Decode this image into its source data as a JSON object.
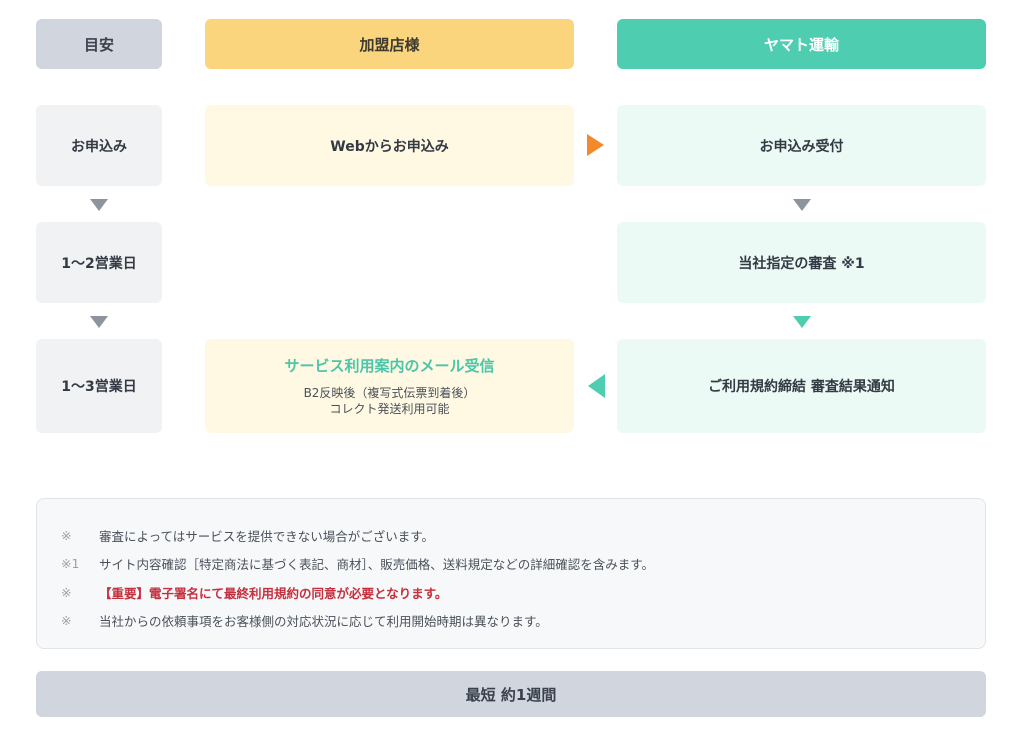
{
  "headers": {
    "guide": "目安",
    "merchant": "加盟店様",
    "yamato": "ヤマト運輸"
  },
  "guide_steps": [
    "お申込み",
    "1〜2営業日",
    "1〜3営業日"
  ],
  "merchant_steps": {
    "step1": "Webからお申込み",
    "step3_title": "サービス利用案内のメール受信",
    "step3_line1": "B2反映後（複写式伝票到着後）",
    "step3_line2": "コレクト発送利用可能"
  },
  "yamato_steps": [
    "お申込み受付",
    "当社指定の審査 ※1",
    "ご利用規約締結 審査結果通知"
  ],
  "notes": [
    {
      "mark": "※",
      "text": "審査によってはサービスを提供できない場合がございます。"
    },
    {
      "mark": "※1",
      "text": "サイト内容確認［特定商法に基づく表記、商材］、販売価格、送料規定などの詳細確認を含みます。"
    },
    {
      "mark": "※",
      "text": "【重要】電子署名にて最終利用規約の同意が必要となります。"
    },
    {
      "mark": "※",
      "text": "当社からの依頼事項をお客様側の対応状況に応じて利用開始時期は異なります。"
    }
  ],
  "total": "最短 約1週間",
  "colors": {
    "header_gray": "#d1d5dd",
    "merchant_yellow": "#fbd57d",
    "yamato_teal": "#4fcdb0",
    "arrow_orange": "#f08a2a",
    "important_red": "#c5303f"
  }
}
